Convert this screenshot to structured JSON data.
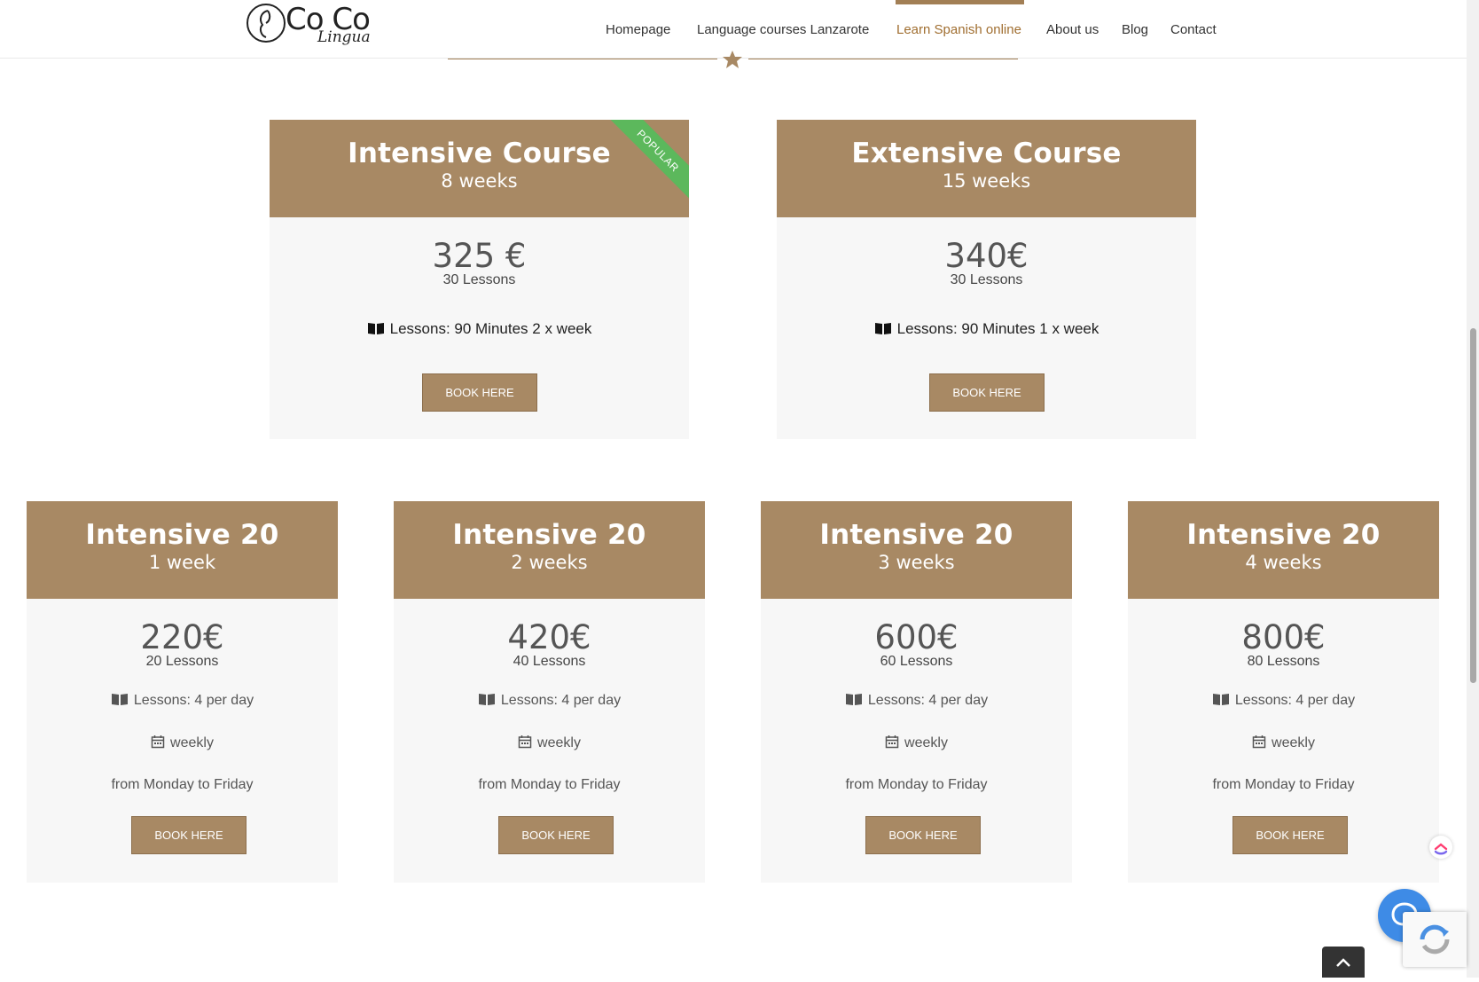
{
  "logo": {
    "main": "Co Co",
    "sub": "Lingua"
  },
  "nav": {
    "items": [
      {
        "label": "Homepage"
      },
      {
        "label": "Language courses Lanzarote"
      },
      {
        "label": "Learn Spanish online"
      },
      {
        "label": "About us"
      },
      {
        "label": "Blog"
      },
      {
        "label": "Contact"
      }
    ],
    "active_index": 2
  },
  "colors": {
    "accent": "#a88964",
    "nav_active": "#a06e30",
    "ribbon": "#5cb85c",
    "help": "#3e8be6"
  },
  "courses_top": [
    {
      "title": "Intensive Course",
      "duration": "8 weeks",
      "ribbon": "POPULAR",
      "price": "325 €",
      "lessons": "30 Lessons",
      "feature": "Lessons: 90 Minutes 2 x week",
      "feature_icon": "book-icon",
      "button": "BOOK HERE"
    },
    {
      "title": "Extensive Course",
      "duration": "15 weeks",
      "price": "340€",
      "lessons": "30 Lessons",
      "feature": "Lessons: 90 Minutes 1 x week",
      "feature_icon": "book-icon",
      "button": "BOOK HERE"
    }
  ],
  "courses_bottom": [
    {
      "title": "Intensive 20",
      "duration": "1 week",
      "price": "220€",
      "lessons": "20 Lessons",
      "feature": "Lessons: 4 per day",
      "schedule": "weekly",
      "days": "from Monday to Friday",
      "button": "BOOK HERE"
    },
    {
      "title": "Intensive 20",
      "duration": "2 weeks",
      "price": "420€",
      "lessons": "40 Lessons",
      "feature": "Lessons: 4 per day",
      "schedule": "weekly",
      "days": "from Monday to Friday",
      "button": "BOOK HERE"
    },
    {
      "title": "Intensive 20",
      "duration": "3 weeks",
      "price": "600€",
      "lessons": "60 Lessons",
      "feature": "Lessons: 4 per day",
      "schedule": "weekly",
      "days": "from Monday to Friday",
      "button": "BOOK HERE"
    },
    {
      "title": "Intensive 20",
      "duration": "4 weeks",
      "price": "800€",
      "lessons": "80 Lessons",
      "feature": "Lessons: 4 per day",
      "schedule": "weekly",
      "days": "from Monday to Friday",
      "button": "BOOK HERE"
    }
  ],
  "widgets": {
    "help_icon": "chat-bubble-icon",
    "totop_icon": "chevron-up-icon",
    "recaptcha_icon": "recaptcha-icon",
    "clickup_icon": "clickup-icon"
  }
}
